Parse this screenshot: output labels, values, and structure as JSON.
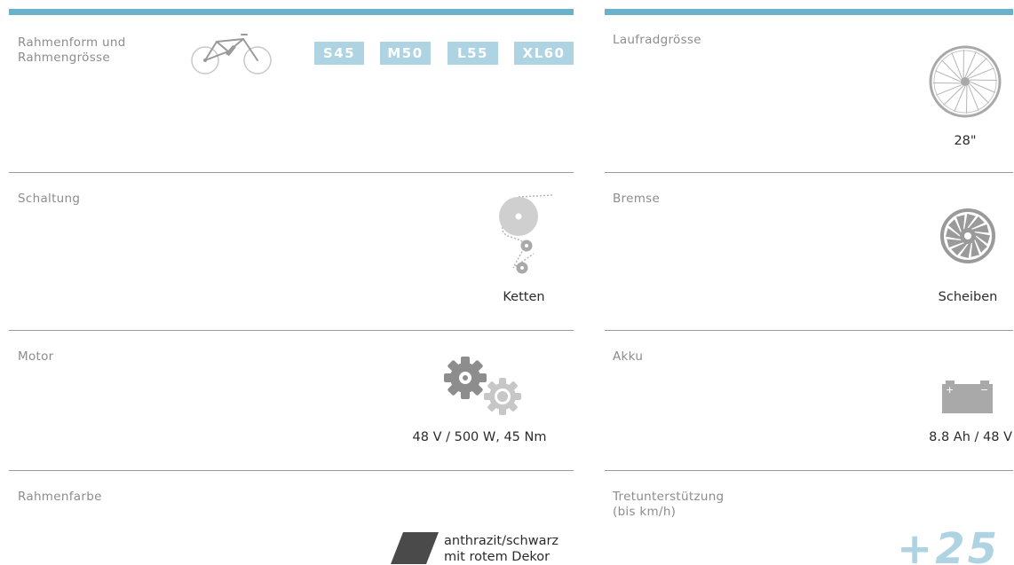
{
  "left": {
    "frame": {
      "label": "Rahmenform und\nRahmengrösse",
      "sizes": [
        "S45",
        "M50",
        "L55",
        "XL60"
      ]
    },
    "shifting": {
      "label": "Schaltung",
      "value": "Ketten"
    },
    "motor": {
      "label": "Motor",
      "value": "48 V / 500 W, 45 Nm"
    },
    "color": {
      "label": "Rahmenfarbe",
      "value_line1": "anthrazit/schwarz",
      "value_line2": "mit rotem Dekor",
      "swatch": "#4a4a4a"
    }
  },
  "right": {
    "wheel": {
      "label": "Laufradgrösse",
      "value": "28\""
    },
    "brake": {
      "label": "Bremse",
      "value": "Scheiben"
    },
    "battery": {
      "label": "Akku",
      "value": "8.8 Ah / 48 V",
      "plus": "+",
      "minus": "−"
    },
    "assist": {
      "label_line1": "Tretunterstützung",
      "label_line2": "(bis km/h)",
      "value": "+25"
    }
  },
  "colors": {
    "accent": "#6ab1cb",
    "badge": "#aed3e2",
    "icon_gray": "#a9a9a9"
  },
  "icons": [
    "bike-frame-icon",
    "wheel-icon",
    "chain-icon",
    "brake-disc-icon",
    "gears-icon",
    "battery-icon",
    "color-swatch-icon"
  ]
}
